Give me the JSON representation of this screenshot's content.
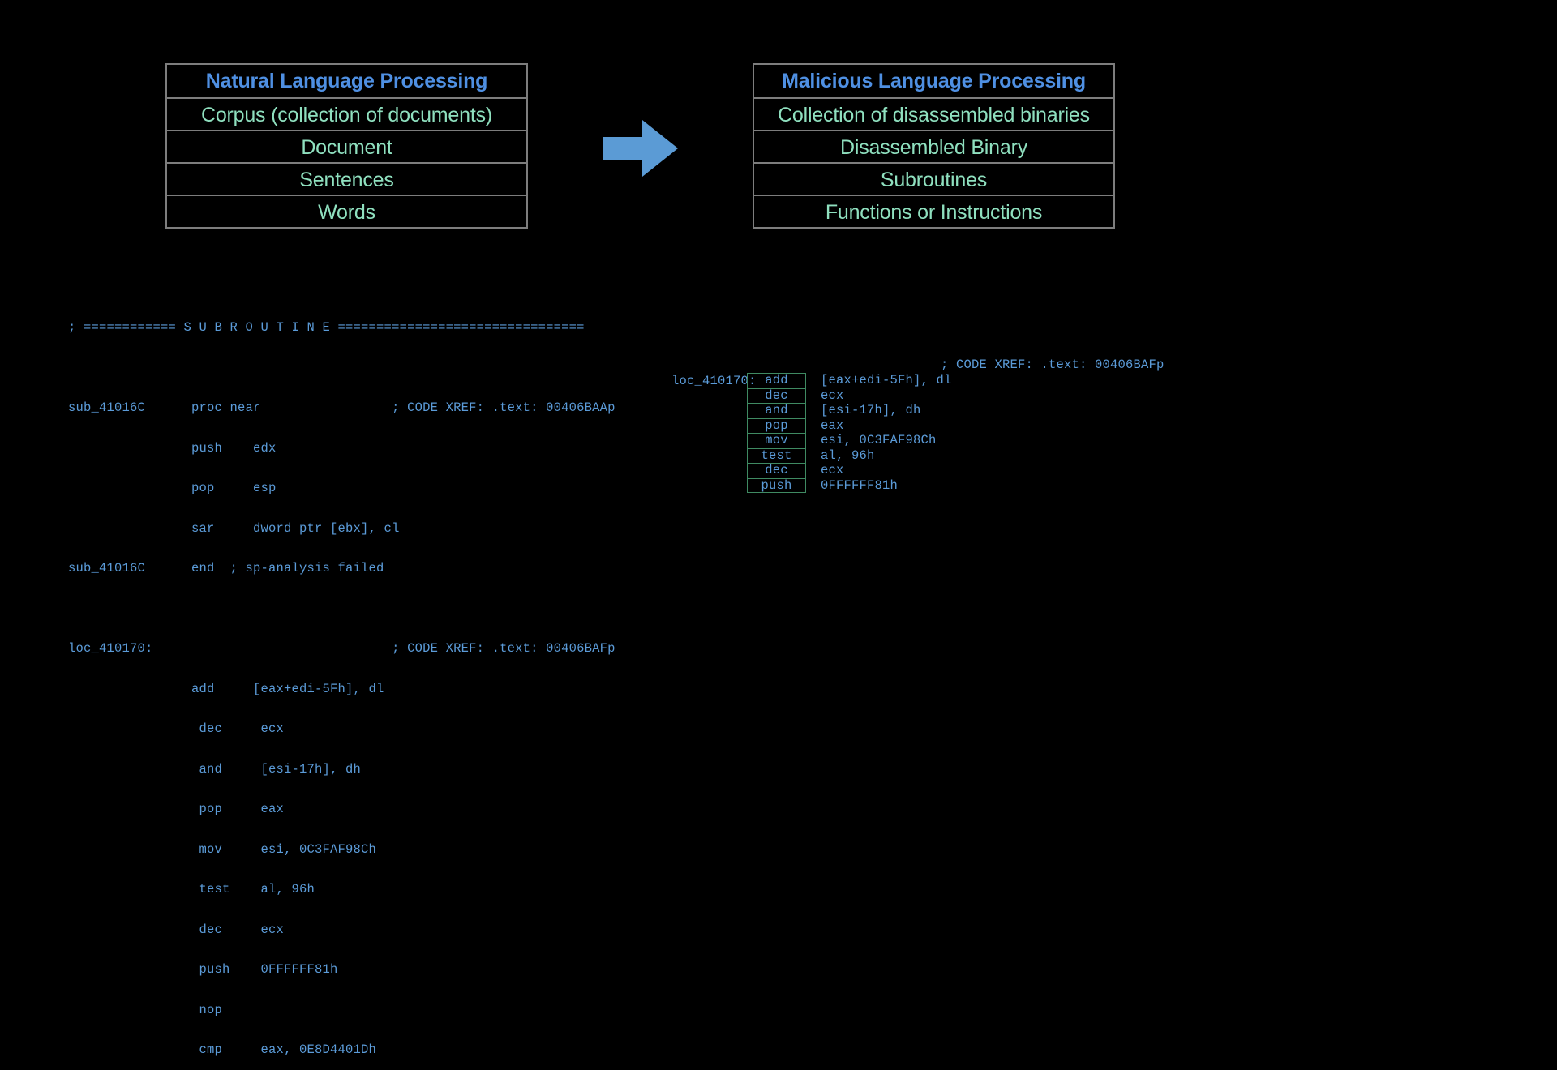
{
  "slide": {
    "background_color": "#000000",
    "accent_blue": "#4f90e3",
    "cell_green": "#8fe0bf",
    "code_blue": "#5b9bd8",
    "token_border_green": "#3f8a62",
    "table_border_gray": "#7d7d7d"
  },
  "nlp_table": {
    "header": "Natural Language Processing",
    "rows": [
      "Corpus (collection of documents)",
      "Document",
      "Sentences",
      "Words"
    ]
  },
  "mlp_table": {
    "header": "Malicious Language Processing",
    "rows": [
      "Collection of disassembled binaries",
      "Disassembled Binary",
      "Subroutines",
      "Functions or Instructions"
    ]
  },
  "arrow": {
    "icon": "arrow-right-icon",
    "color": "#5b9bd5",
    "direction": "right"
  },
  "raw_disassembly": {
    "lines": [
      "; ============ S U B R O U T I N E ================================",
      "",
      "sub_41016C      proc near                 ; CODE XREF: .text: 00406BAAp",
      "                push    edx",
      "                pop     esp",
      "                sar     dword ptr [ebx], cl",
      "sub_41016C      end  ; sp-analysis failed",
      "",
      "loc_410170:                               ; CODE XREF: .text: 00406BAFp",
      "                add     [eax+edi-5Fh], dl",
      "                 dec     ecx",
      "                 and     [esi-17h], dh",
      "                 pop     eax",
      "                 mov     esi, 0C3FAF98Ch",
      "                 test    al, 96h",
      "                 dec     ecx",
      "                 push    0FFFFFF81h",
      "                 nop",
      "                 cmp     eax, 0E8D4401Dh"
    ]
  },
  "tokenized_disassembly": {
    "label": "loc_410170:",
    "xref": "; CODE XREF: .text: 00406BAFp",
    "tokens": [
      {
        "mnemonic": "add",
        "operands": "[eax+edi-5Fh], dl"
      },
      {
        "mnemonic": "dec",
        "operands": "ecx"
      },
      {
        "mnemonic": "and",
        "operands": "[esi-17h], dh"
      },
      {
        "mnemonic": "pop",
        "operands": "eax"
      },
      {
        "mnemonic": "mov",
        "operands": "esi, 0C3FAF98Ch"
      },
      {
        "mnemonic": "test",
        "operands": "al, 96h"
      },
      {
        "mnemonic": "dec",
        "operands": "ecx"
      },
      {
        "mnemonic": "push",
        "operands": "0FFFFFF81h"
      }
    ]
  }
}
